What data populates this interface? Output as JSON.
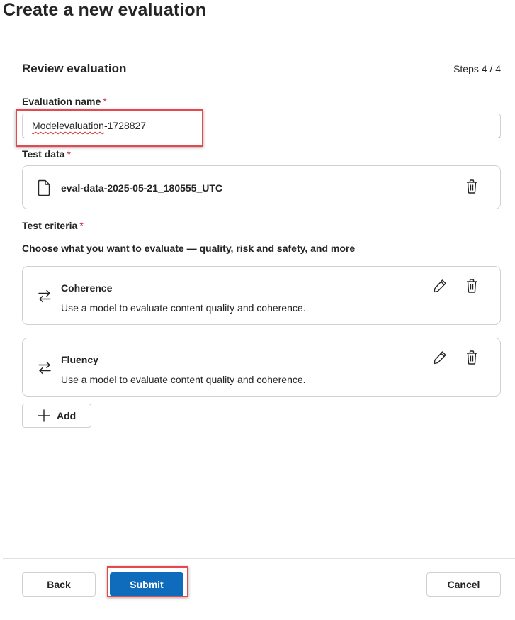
{
  "header": {
    "title": "Create a new evaluation"
  },
  "review": {
    "title": "Review evaluation",
    "steps": "Steps 4 / 4"
  },
  "evaluation_name": {
    "label": "Evaluation name",
    "required_mark": "*",
    "value_part1": "Modelevaluation",
    "value_part2": "-1728827"
  },
  "test_data": {
    "label": "Test data",
    "required_mark": "*",
    "file_name": "eval-data-2025-05-21_180555_UTC"
  },
  "test_criteria": {
    "label": "Test criteria",
    "required_mark": "*",
    "description": "Choose what you want to evaluate — quality, risk and safety, and more",
    "items": [
      {
        "title": "Coherence",
        "description": "Use a model to evaluate content quality and coherence."
      },
      {
        "title": "Fluency",
        "description": "Use a model to evaluate content quality and coherence."
      }
    ],
    "add_label": "Add"
  },
  "footer": {
    "back_label": "Back",
    "submit_label": "Submit",
    "cancel_label": "Cancel"
  },
  "colors": {
    "primary": "#0f6cbd",
    "required": "#c4314b",
    "highlight": "#e5484d"
  },
  "icons": {
    "file": "document-icon",
    "delete": "trash-icon",
    "edit": "pencil-icon",
    "criteria": "arrows-swap-icon",
    "add": "plus-icon"
  }
}
